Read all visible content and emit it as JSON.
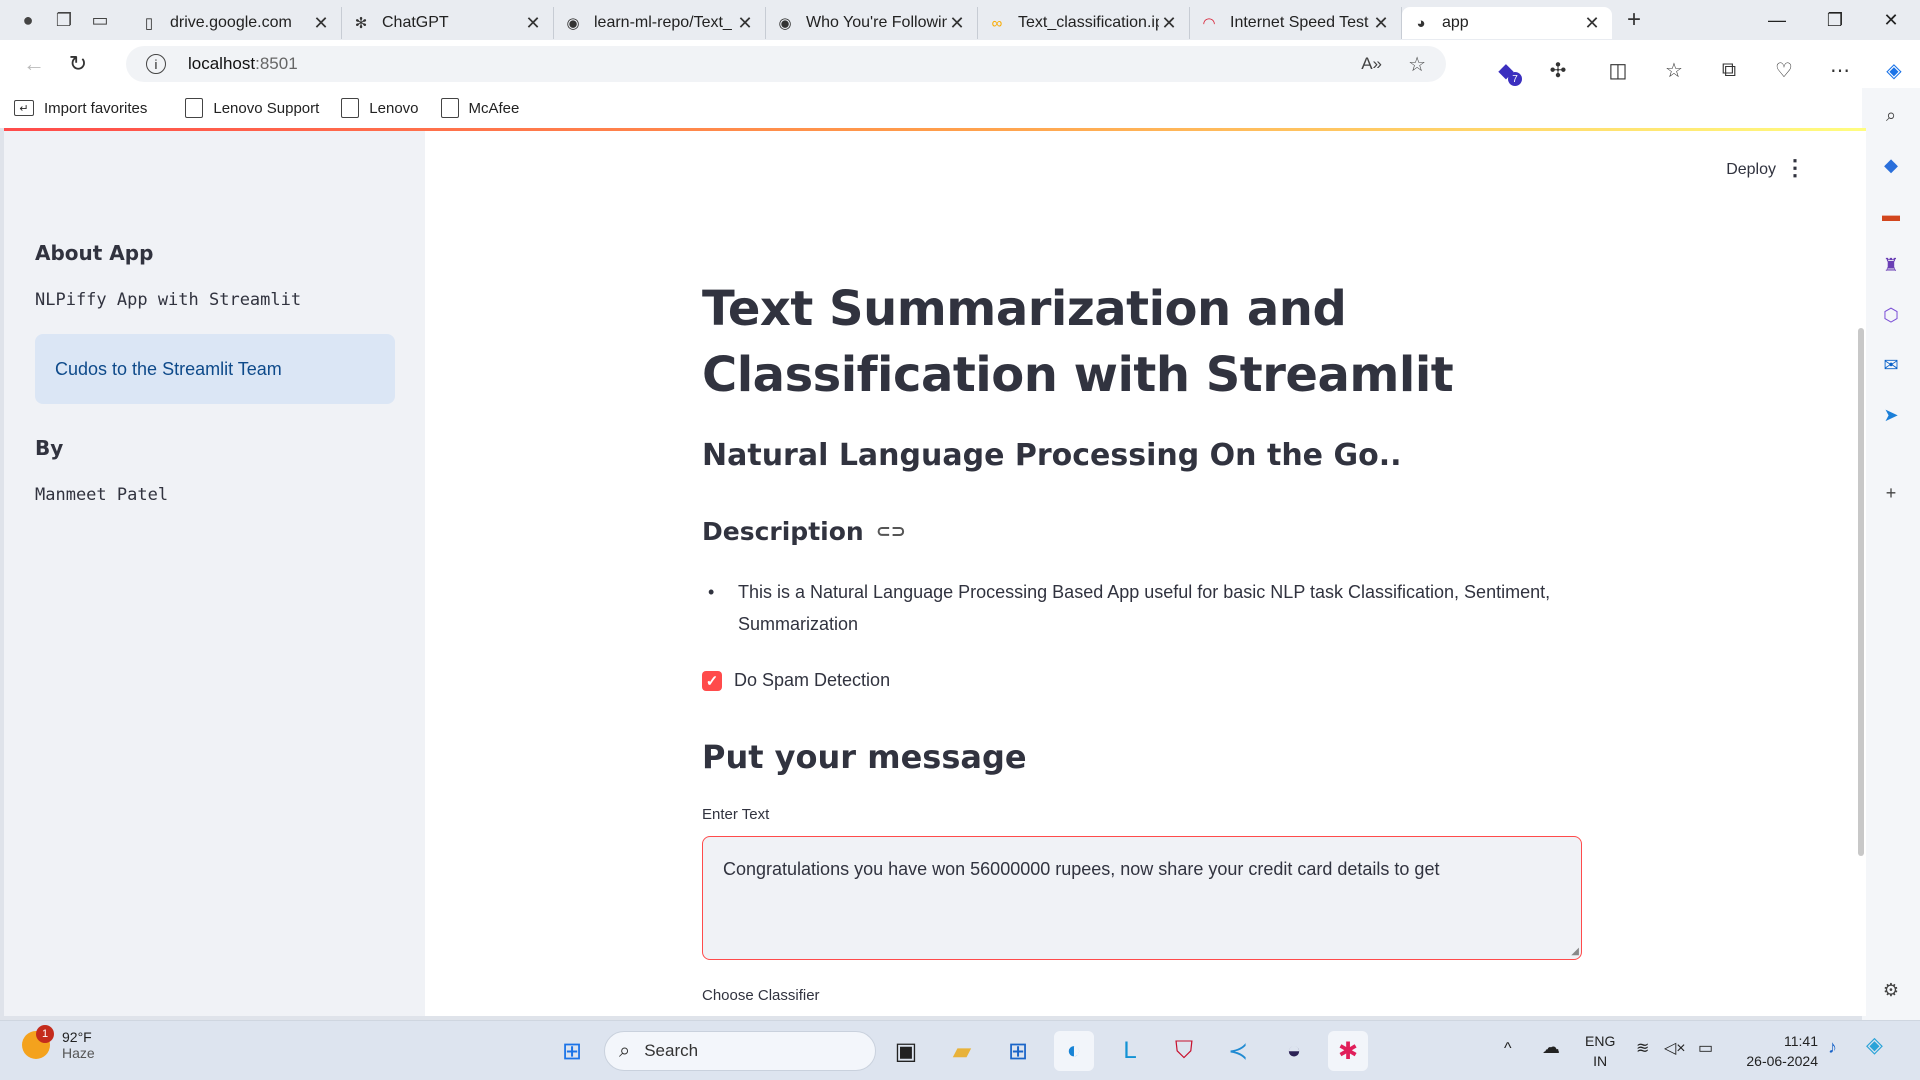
{
  "browser": {
    "tabs": [
      {
        "title": "drive.google.com",
        "icon": "drive-doc-icon"
      },
      {
        "title": "ChatGPT",
        "icon": "chatgpt-icon"
      },
      {
        "title": "learn-ml-repo/Text_",
        "icon": "github-icon"
      },
      {
        "title": "Who You're Followin",
        "icon": "github-icon"
      },
      {
        "title": "Text_classification.ip",
        "icon": "colab-icon"
      },
      {
        "title": "Internet Speed Test",
        "icon": "speedtest-icon"
      },
      {
        "title": "app",
        "icon": "streamlit-icon",
        "active": true
      }
    ],
    "url_host": "localhost",
    "url_port": ":8501",
    "favorites": [
      "Import favorites",
      "Lenovo Support",
      "Lenovo",
      "McAfee"
    ],
    "extension_badge": "7"
  },
  "app": {
    "header": {
      "deploy_label": "Deploy"
    },
    "sidebar": {
      "about_heading": "About App",
      "about_text": "NLPiffy App with Streamlit",
      "info_text": "Cudos to the Streamlit Team",
      "by_heading": "By",
      "author": "Manmeet Patel"
    },
    "main": {
      "title": "Text Summarization and Classification with Streamlit",
      "subtitle": "Natural Language Processing On the Go..",
      "description_heading": "Description",
      "description_bullet": "This is a Natural Language Processing Based App useful for basic NLP task Classification, Sentiment, Summarization",
      "spam_checkbox_label": "Do Spam Detection",
      "spam_checked": true,
      "message_heading": "Put your message",
      "enter_text_label": "Enter Text",
      "enter_text_value": "Congratulations you have won 56000000 rupees, now share your credit card details to get",
      "choose_classifier_label": "Choose Classifier"
    },
    "accent_color": "#ff4b4b"
  },
  "taskbar": {
    "weather_temp": "92°F",
    "weather_cond": "Haze",
    "weather_badge": "1",
    "search_label": "Search",
    "lang": "ENG",
    "region": "IN",
    "time": "11:41",
    "date": "26-06-2024"
  }
}
